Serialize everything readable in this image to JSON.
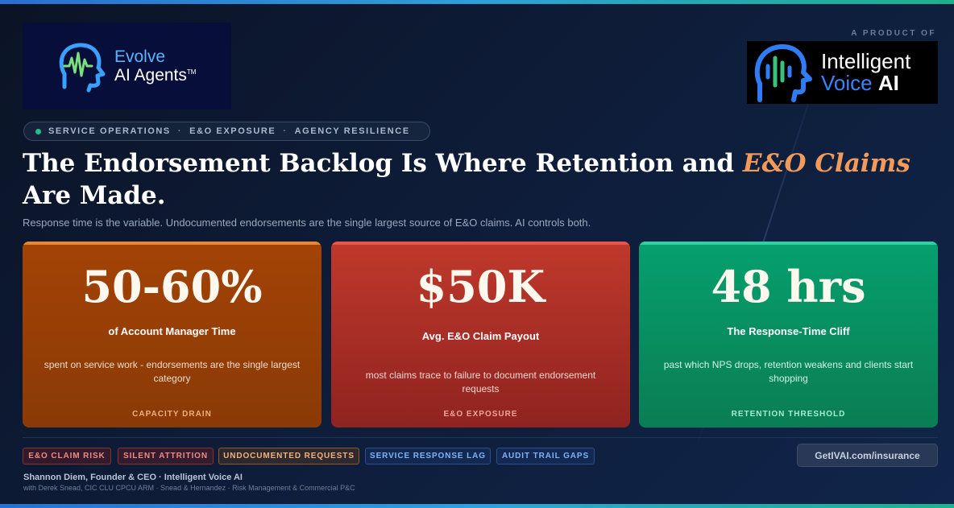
{
  "brand": {
    "evolve_title": "Evolve",
    "evolve_sub": "AI Agents",
    "evolve_tm": "TM",
    "product_of": "A PRODUCT OF",
    "ivai_line1": "Intelligent",
    "ivai_voice": "Voice",
    "ivai_ai": "AI"
  },
  "pill": {
    "items": [
      "SERVICE OPERATIONS",
      "E&O EXPOSURE",
      "AGENCY RESILIENCE"
    ],
    "separator": "·",
    "dot_color": "#21c08b"
  },
  "headline": {
    "part1": "The Endorsement Backlog Is Where Retention and ",
    "accent": "E&O Claims",
    "part2": "Are Made."
  },
  "subline": "Response time is the variable. Undocumented endorsements are the single largest source of E&O claims. AI controls both.",
  "cards": [
    {
      "value": "50-60%",
      "label": "of Account Manager Time",
      "description": "spent on service work - endorsements are the single largest category",
      "tag": "CAPACITY DRAIN",
      "color": "#a34306"
    },
    {
      "value": "$50K",
      "label": "Avg. E&O Claim Payout",
      "description": "most claims trace to failure to document endorsement requests",
      "tag": "E&O EXPOSURE",
      "color": "#c0392b"
    },
    {
      "value": "48 hrs",
      "label": "The Response-Time Cliff",
      "description": "past which NPS drops, retention weakens and clients start shopping",
      "tag": "RETENTION THRESHOLD",
      "color": "#06a06e"
    }
  ],
  "chips": [
    {
      "label": "E&O CLAIM RISK",
      "tone": "red"
    },
    {
      "label": "SILENT ATTRITION",
      "tone": "red"
    },
    {
      "label": "UNDOCUMENTED REQUESTS",
      "tone": "orange"
    },
    {
      "label": "SERVICE RESPONSE LAG",
      "tone": "blue"
    },
    {
      "label": "AUDIT TRAIL GAPS",
      "tone": "blue"
    }
  ],
  "cta_url": "GetIVAI.com/insurance",
  "footer": {
    "founder": "Shannon Diem, Founder & CEO · Intelligent Voice AI",
    "with": "with Derek Snead, CIC CLU CPCU ARM · Snead & Hernandez · Risk Management & Commercial P&C"
  }
}
